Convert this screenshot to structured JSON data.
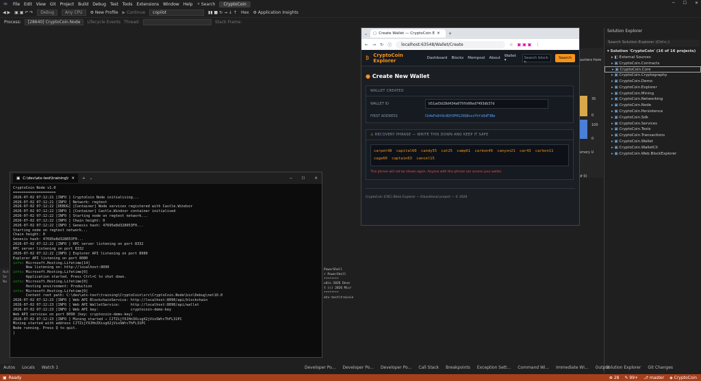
{
  "vs": {
    "menu": [
      "File",
      "Edit",
      "View",
      "Git",
      "Project",
      "Build",
      "Debug",
      "Test",
      "Tools",
      "Extensions",
      "Window",
      "Help"
    ],
    "search": "Search",
    "title": "CryptoCoin",
    "toolbar": {
      "config": "Debug",
      "platform": "Any CPU",
      "profile": "New Profile",
      "continue": "Continue",
      "copilot": "copilot",
      "hex": "Hex",
      "insights": "Application Insights"
    },
    "procbar": {
      "process_label": "Process:",
      "process": "[28640] CryptoCoin.Node",
      "lifecycle": "Lifecycle Events",
      "thread": "Thread:",
      "stackframe": "Stack Frame:"
    },
    "status": {
      "ready": "Ready",
      "errors": "28",
      "warnings": "99+",
      "branch": "master",
      "repo": "CryptoCoin"
    },
    "bottom_left_tabs": [
      "Autos",
      "Locals",
      "Watch 1"
    ],
    "bottom_right_tabs": [
      "Developer Po...",
      "Developer Po...",
      "Developer Po...",
      "Call Stack",
      "Breakpoints",
      "Exception Sett...",
      "Command Wi...",
      "Immediate Wi...",
      "Output"
    ],
    "sol_tabs": [
      "Solution Explorer",
      "Git Changes"
    ]
  },
  "solution": {
    "title": "Solution Explorer",
    "search": "Search Solution Explorer (Ctrl+;)",
    "root": "Solution 'CryptoCoin' (16 of 16 projects)",
    "items": [
      "External Sources",
      "CryptoCoin.Contracts",
      "CryptoCoin.Core",
      "CryptoCoin.Cryptography",
      "CryptoCoin.Demo",
      "CryptoCoin.Explorer",
      "CryptoCoin.Mining",
      "CryptoCoin.Networking",
      "CryptoCoin.Node",
      "CryptoCoin.Persistence",
      "CryptoCoin.Sdk",
      "CryptoCoin.Services",
      "CryptoCoin.Tests",
      "CryptoCoin.Transactions",
      "CryptoCoin.Wallet",
      "CryptoCoin.WalletCli",
      "CryptoCoin.Web.BlockExplorer"
    ]
  },
  "diag": {
    "val1": "35",
    "val2": "0",
    "val3": "100",
    "val4": "0",
    "counters": "ounters from",
    "memory": "emory U",
    "of0": "of 0)"
  },
  "browser": {
    "tab_title": "Create Wallet — CryptoCoin E",
    "url": "localhost:63548/Wallet/Create",
    "site": {
      "logo": "CryptoCoin Explorer",
      "nav": [
        "Dashboard",
        "Blocks",
        "Mempool",
        "About",
        "Wallet"
      ],
      "search_placeholder": "Search block h",
      "search_btn": "Search"
    },
    "heading": "Create New Wallet",
    "created_header": "WALLET CREATED",
    "wallet_id_label": "WALLET ID",
    "wallet_id": "b51ad3d28d434a079fb00ed7493db37d",
    "first_address_label": "FIRST ADDRESS",
    "first_address": "Cb4eFe8t8c8QfUPH129Q8nzzYhfxDdF3Be",
    "recovery_header": "RECOVERY PHRASE — WRITE THIS DOWN AND KEEP IT SAFE",
    "phrase": "carpet48 capital60 candy55 cat25 camp61 carbon49 canyon21 car43 carbon11 cage60 captain63 cancel15",
    "warning": "This phrase will not be shown again. Anyone with this phrase can access your wallet.",
    "footer": "CryptoCoin (CRC) Block Explorer — Educational project — © 2026"
  },
  "terminal": {
    "tab": "C:\\dev\\atx-test\\training\\Cryp",
    "lines": [
      "CryptoCoin Node v1.0",
      "====================",
      "2026-07-02 07:12:21 [INFO ] CryptoCoin Node initialising...",
      "2026-07-02 07:12:21 [INFO ] Network: regtest",
      "2026-07-02 07:12:22 [DEBUG] [Container] Node services registered with Castle.Windsor",
      "2026-07-02 07:12:22 [INFO ] [Container] Castle.Windsor container initialised",
      "2026-07-02 07:12:22 [INFO ] Starting node on regtest network...",
      "2026-07-02 07:12:22 [INFO ] Chain height: 0",
      "2026-07-02 07:12:22 [INFO ] Genesis hash: 47695e8d328053F0...",
      "Starting node on regtest network...",
      "Chain height: 0",
      "Genesis hash: 47695e8d328053F0...",
      "2026-07-02 07:12:22 [INFO ] RPC server listening on port 8332",
      "RPC server listening on port 8332",
      "2026-07-02 07:12:22 [INFO ] Explorer API listening on port 8080",
      "Explorer API listening on port 8080",
      "info: Microsoft.Hosting.Lifetime[14]",
      "      Now listening on: http://localhost:8090",
      "info: Microsoft.Hosting.Lifetime[0]",
      "      Application started. Press Ctrl+C to shut down.",
      "info: Microsoft.Hosting.Lifetime[0]",
      "      Hosting environment: Production",
      "info: Microsoft.Hosting.Lifetime[0]",
      "      Content root path: C:\\dev\\atx-test\\training\\CryptoCoin\\src\\CryptoCoin.Node\\bin\\Debug\\net10.0",
      "2026-07-02 07:12:23 [INFO ] Web API BlockchainService: http://localhost:8090/api/blockchain",
      "2026-07-02 07:12:23 [INFO ] Web API WalletService:     http://localhost:8090/api/wallet",
      "2026-07-02 07:12:23 [INFO ] Web API key:               cryptocoin-demo-key",
      "Web API services on port 8090 (key: cryptocoin-demo-key)",
      "2026-07-02 07:12:23 [INFO ] Mining started → CJTZijYXJHn3XisgX2jVioSWtcThFL31PC",
      "Mining started with address CJTZijYXJHn3XisgX2jVioSWtcThFL31PC",
      "Node running. Press Q to quit."
    ]
  },
  "ps": {
    "lines": [
      "PowerShell",
      "r PowerShell",
      "********",
      "udio 2026 Deve",
      "t (c) 2026 Micr",
      "********",
      "atx-test\\trainin"
    ]
  },
  "autos": {
    "lines": [
      "Aut",
      "Se",
      "Na"
    ]
  }
}
